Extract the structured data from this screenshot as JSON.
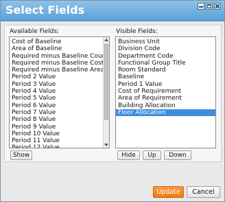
{
  "dialog": {
    "title": "Select Fields",
    "window_buttons": [
      "minimize-icon",
      "maximize-icon",
      "close-icon"
    ]
  },
  "available": {
    "label": "Available Fields:",
    "items": [
      "Cost of Baseline",
      "Area of Baseline",
      "Required minus Baseline Count",
      "Required minus Baseline Cost",
      "Required minus Baseline Area",
      "Period 2 Value",
      "Period 3 Value",
      "Period 4 Value",
      "Period 5 Value",
      "Period 6 Value",
      "Period 7 Value",
      "Period 8 Value",
      "Period 9 Value",
      "Period 10 Value",
      "Period 11 Value",
      "Period 12 Value"
    ],
    "show_button": "Show"
  },
  "visible": {
    "label": "Visible Fields:",
    "items": [
      "Business Unit",
      "Division Code",
      "Department Code",
      "Functional Group Title",
      "Room Standard",
      "Baseline",
      "Period 1 Value",
      "Cost of Requirement",
      "Area of Requirement",
      "Building Allocation",
      "Floor Allocation"
    ],
    "selected": "Floor Allocation",
    "hide_button": "Hide",
    "up_button": "Up",
    "down_button": "Down"
  },
  "footer": {
    "update_label": "Update",
    "cancel_label": "Cancel"
  },
  "colors": {
    "title_bar": "#5aa2d6",
    "selection": "#3d8ee0",
    "update_button": "#ed7a13"
  }
}
